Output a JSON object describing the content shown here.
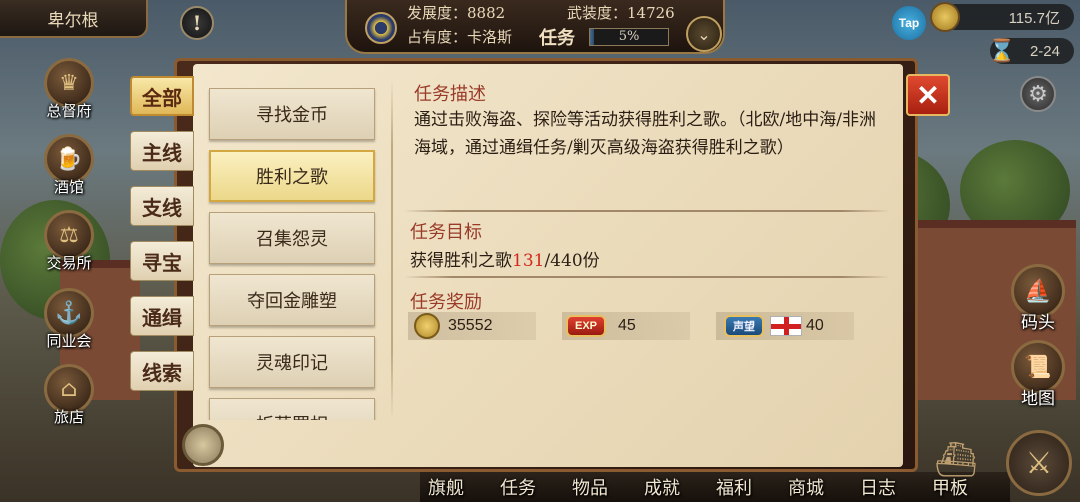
{
  "city": {
    "name": "卑尔根"
  },
  "top_stats": {
    "development": "发展度：8882",
    "armament": "武装度：14726",
    "occupancy": "占有度：卡洛斯",
    "task_label": "任务",
    "task_progress_text": "5%",
    "task_progress": 0.05
  },
  "resources": {
    "tap": "Tap",
    "gold": "115.7亿",
    "date": "2-24"
  },
  "left_nav": [
    {
      "label": "总督府",
      "icon": "crown-icon"
    },
    {
      "label": "酒馆",
      "icon": "beer-mug-icon"
    },
    {
      "label": "交易所",
      "icon": "scales-icon"
    },
    {
      "label": "同业会",
      "icon": "anchor-shield-icon"
    },
    {
      "label": "旅店",
      "icon": "inn-icon"
    }
  ],
  "right_nav": [
    {
      "label": "码头",
      "icon": "dock-icon"
    },
    {
      "label": "地图",
      "icon": "map-scroll-icon"
    }
  ],
  "categories": [
    {
      "label": "全部",
      "active": true
    },
    {
      "label": "主线",
      "active": false
    },
    {
      "label": "支线",
      "active": false
    },
    {
      "label": "寻宝",
      "active": false
    },
    {
      "label": "通缉",
      "active": false
    },
    {
      "label": "线索",
      "active": false
    }
  ],
  "quests": [
    {
      "label": "寻找金币",
      "active": false
    },
    {
      "label": "胜利之歌",
      "active": true
    },
    {
      "label": "召集怨灵",
      "active": false
    },
    {
      "label": "夺回金雕塑",
      "active": false
    },
    {
      "label": "灵魂印记",
      "active": false
    },
    {
      "label": "折草罪相",
      "active": false
    }
  ],
  "detail": {
    "desc_title": "任务描述",
    "desc_text": "通过击败海盗、探险等活动获得胜利之歌。（北欧/地中海/非洲海域，通过通缉任务/剿灭高级海盗获得胜利之歌）",
    "goal_title": "任务目标",
    "goal_prefix": "获得胜利之歌",
    "goal_current": "131",
    "goal_suffix": "/440份",
    "reward_title": "任务奖励",
    "rewards": {
      "gold": "35552",
      "exp_badge": "EXP",
      "exp": "45",
      "fame_badge": "声望",
      "fame": "40"
    }
  },
  "bottom_nav": [
    "旗舰",
    "任务",
    "物品",
    "成就",
    "福利",
    "商城",
    "日志",
    "甲板"
  ],
  "colors": {
    "accent_red": "#d02a20",
    "title_red": "#9a3a28",
    "active_tab_gold": "#e0b858"
  }
}
